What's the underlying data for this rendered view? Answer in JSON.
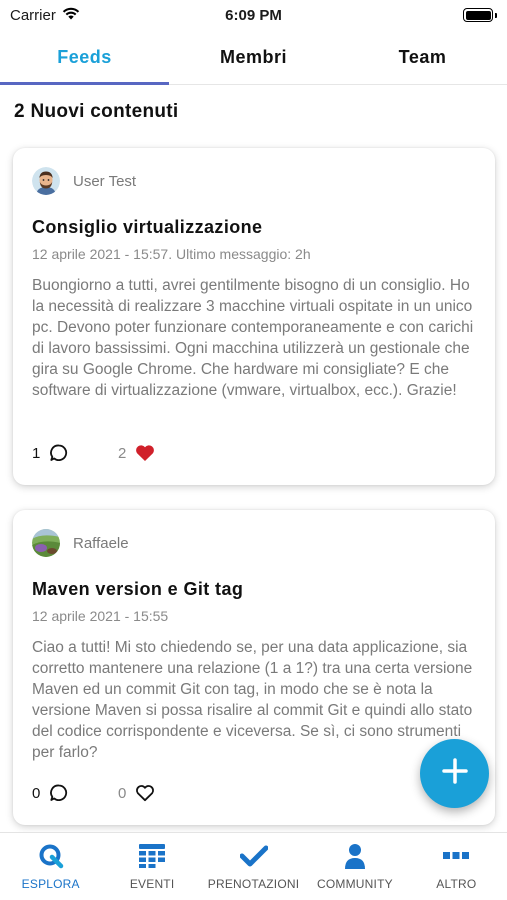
{
  "status_bar": {
    "carrier": "Carrier",
    "time": "6:09 PM"
  },
  "tabs": [
    {
      "label": "Feeds",
      "active": true
    },
    {
      "label": "Membri",
      "active": false
    },
    {
      "label": "Team",
      "active": false
    }
  ],
  "new_content": "2 Nuovi contenuti",
  "posts": [
    {
      "author": "User Test",
      "title": "Consiglio virtualizzazione",
      "meta": "12 aprile 2021 - 15:57. Ultimo messaggio: 2h",
      "body": "Buongiorno a tutti, avrei gentilmente bisogno di un consiglio. Ho la necessità di realizzare 3 macchine virtuali ospitate in un unico pc. Devono poter funzionare contemporaneamente e con carichi di lavoro bassissimi. Ogni macchina utilizzerà un gestionale che gira su Google Chrome. Che hardware mi consigliate? E che software di virtualizzazione (vmware, virtualbox, ecc.). Grazie!",
      "comments": "1",
      "likes": "2",
      "liked": true
    },
    {
      "author": "Raffaele",
      "title": "Maven version e Git tag",
      "meta": "12 aprile 2021 - 15:55",
      "body": "Ciao a tutti! Mi sto chiedendo se, per una data applicazione, sia corretto mantenere una relazione (1 a 1?) tra una certa versione Maven ed un commit Git con tag, in modo che se è nota la versione Maven si possa risalire al commit Git e quindi allo stato del codice corrispondente e viceversa. Se sì, ci sono strumenti per farlo?",
      "comments": "0",
      "likes": "0",
      "liked": false
    }
  ],
  "bottom_nav": [
    {
      "label": "ESPLORA",
      "icon": "explore-q-icon",
      "active": true
    },
    {
      "label": "EVENTI",
      "icon": "calendar-grid-icon",
      "active": false
    },
    {
      "label": "PRENOTAZIONI",
      "icon": "checkmark-icon",
      "active": false
    },
    {
      "label": "COMMUNITY",
      "icon": "person-icon",
      "active": false
    },
    {
      "label": "ALTRO",
      "icon": "more-dots-icon",
      "active": false
    }
  ],
  "colors": {
    "accent": "#1aa0d8",
    "tab_indicator": "#5867c2",
    "like": "#d0202a",
    "nav_active": "#1a73c8"
  }
}
